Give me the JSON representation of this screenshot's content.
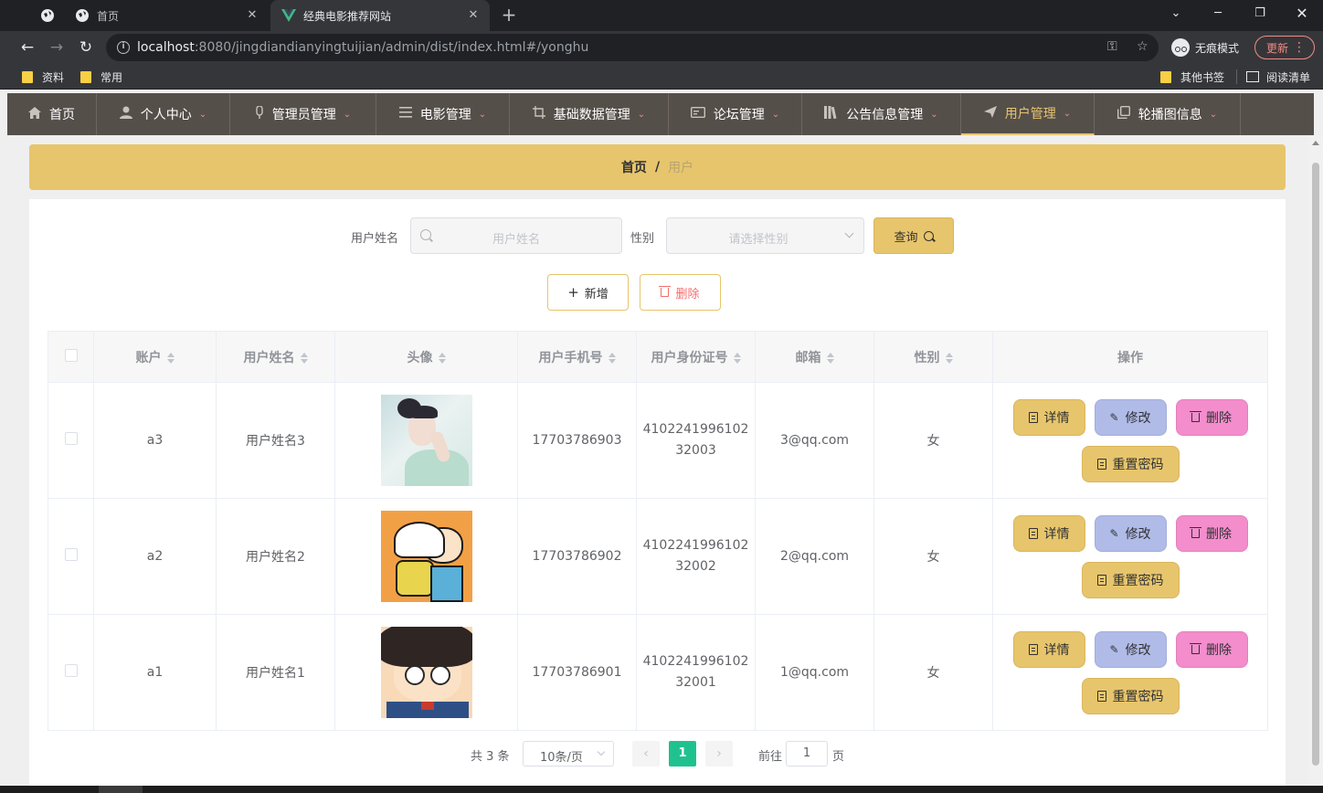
{
  "browser": {
    "tabs": [
      {
        "title": "首页",
        "active": false
      },
      {
        "title": "经典电影推荐网站",
        "active": true
      }
    ],
    "url_host": "localhost",
    "url_rest": ":8080/jingdiandianyingtuijian/admin/dist/index.html#/yonghu",
    "incognito_label": "无痕模式",
    "update_label": "更新",
    "bookmarks": [
      "资料",
      "常用"
    ],
    "other_bookmarks": "其他书签",
    "reading_list": "阅读清单"
  },
  "nav": {
    "items": [
      {
        "label": "首页",
        "icon": "home-icon"
      },
      {
        "label": "个人中心",
        "icon": "user-icon"
      },
      {
        "label": "管理员管理",
        "icon": "mic-icon"
      },
      {
        "label": "电影管理",
        "icon": "list-icon"
      },
      {
        "label": "基础数据管理",
        "icon": "crop-icon"
      },
      {
        "label": "论坛管理",
        "icon": "card-icon"
      },
      {
        "label": "公告信息管理",
        "icon": "books-icon"
      },
      {
        "label": "用户管理",
        "icon": "send-icon",
        "active": true
      },
      {
        "label": "轮播图信息",
        "icon": "copy-icon"
      }
    ],
    "accent_color": "#e7c470"
  },
  "breadcrumb": {
    "home": "首页",
    "separator": "/",
    "current": "用户"
  },
  "search": {
    "name_label": "用户姓名",
    "name_placeholder": "用户姓名",
    "gender_label": "性别",
    "gender_placeholder": "请选择性别",
    "query_label": "查询"
  },
  "actions": {
    "add_label": "新增",
    "delete_label": "删除"
  },
  "table": {
    "headers": [
      "账户",
      "用户姓名",
      "头像",
      "用户手机号",
      "用户身份证号",
      "邮箱",
      "性别",
      "操作"
    ],
    "rows": [
      {
        "account": "a3",
        "name": "用户姓名3",
        "avatar": "woman-portrait",
        "phone": "17703786903",
        "id_line1": "4102241996102",
        "id_line2": "32003",
        "email": "3@qq.com",
        "gender": "女"
      },
      {
        "account": "a2",
        "name": "用户姓名2",
        "avatar": "cartoon-boy-cap",
        "phone": "17703786902",
        "id_line1": "4102241996102",
        "id_line2": "32002",
        "email": "2@qq.com",
        "gender": "女"
      },
      {
        "account": "a1",
        "name": "用户姓名1",
        "avatar": "cartoon-boy-glasses",
        "phone": "17703786901",
        "id_line1": "4102241996102",
        "id_line2": "32001",
        "email": "1@qq.com",
        "gender": "女"
      }
    ],
    "row_actions": {
      "detail": "详情",
      "edit": "修改",
      "remove": "删除",
      "reset": "重置密码"
    }
  },
  "pagination": {
    "total_text": "共 3 条",
    "page_size": "10条/页",
    "current_page": "1",
    "goto_label": "前往",
    "goto_value": "1",
    "page_suffix": "页"
  }
}
